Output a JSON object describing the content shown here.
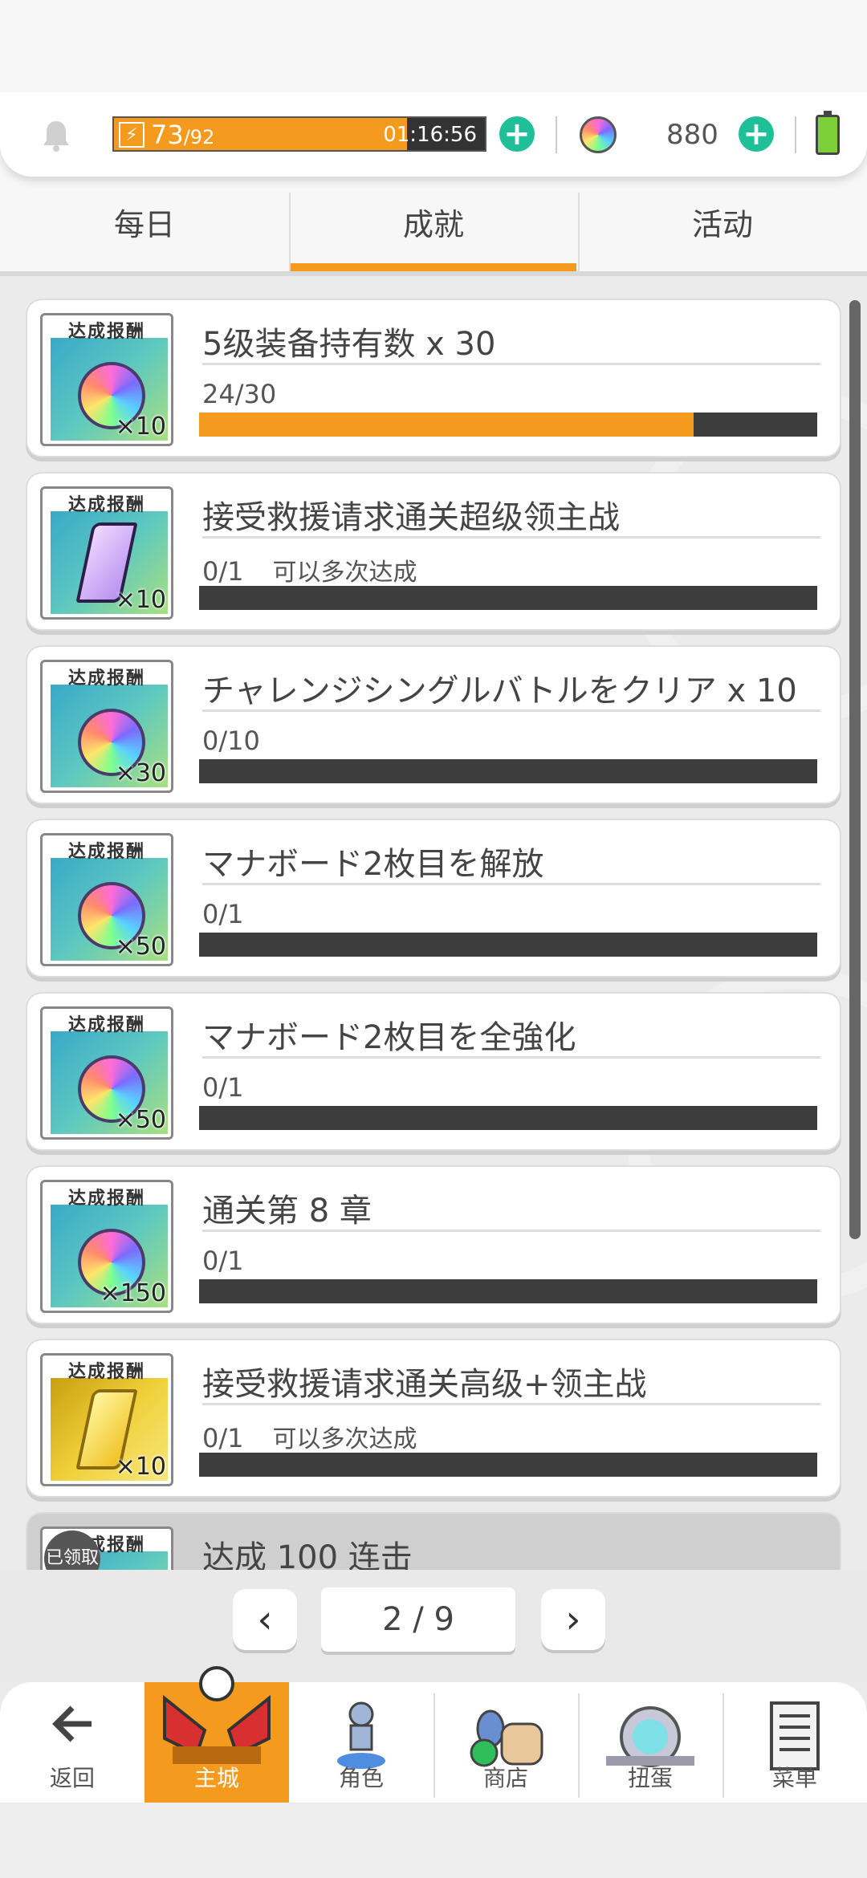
{
  "status": {
    "stamina_current": "73",
    "stamina_max": "/92",
    "stamina_fraction": 0.79,
    "stamina_timer": "01:16:56",
    "gems": "880"
  },
  "tabs": [
    {
      "label": "每日"
    },
    {
      "label": "成就"
    },
    {
      "label": "活动"
    }
  ],
  "reward_label": "达成报酬",
  "claimed_label": "已领取",
  "achievements": [
    {
      "title": "5级装备持有数 x 30",
      "progress": "24/30",
      "note": "",
      "fraction": 0.8,
      "qty": "×10",
      "reward": "rainbow-orb"
    },
    {
      "title": "接受救援请求通关超级领主战",
      "progress": "0/1",
      "note": "可以多次达成",
      "fraction": 0,
      "qty": "×10",
      "reward": "purple-crystal"
    },
    {
      "title": "チャレンジシングルバトルをクリア x 10",
      "progress": "0/10",
      "note": "",
      "fraction": 0,
      "qty": "×30",
      "reward": "rainbow-orb"
    },
    {
      "title": "マナボード2枚目を解放",
      "progress": "0/1",
      "note": "",
      "fraction": 0,
      "qty": "×50",
      "reward": "rainbow-orb"
    },
    {
      "title": "マナボード2枚目を全強化",
      "progress": "0/1",
      "note": "",
      "fraction": 0,
      "qty": "×50",
      "reward": "rainbow-orb"
    },
    {
      "title": "通关第 8 章",
      "progress": "0/1",
      "note": "",
      "fraction": 0,
      "qty": "×150",
      "reward": "rainbow-orb"
    },
    {
      "title": "接受救援请求通关高级+领主战",
      "progress": "0/1",
      "note": "可以多次达成",
      "fraction": 0,
      "qty": "×10",
      "reward": "gold-crystal"
    },
    {
      "title": "达成 100 连击",
      "progress": "",
      "note": "",
      "fraction": 0,
      "qty": "",
      "reward": "rainbow-orb",
      "claimed": true
    }
  ],
  "pager": {
    "page": "2 / 9"
  },
  "nav": [
    {
      "label": "返回",
      "icon": "back-arrow-icon"
    },
    {
      "label": "主城",
      "icon": "castle-icon"
    },
    {
      "label": "角色",
      "icon": "character-icon"
    },
    {
      "label": "商店",
      "icon": "shop-icon"
    },
    {
      "label": "扭蛋",
      "icon": "gacha-icon"
    },
    {
      "label": "菜单",
      "icon": "menu-icon"
    }
  ],
  "colors": {
    "accent": "#f49b1f",
    "plus": "#1fbf97",
    "bar_bg": "#3d3d3d"
  }
}
